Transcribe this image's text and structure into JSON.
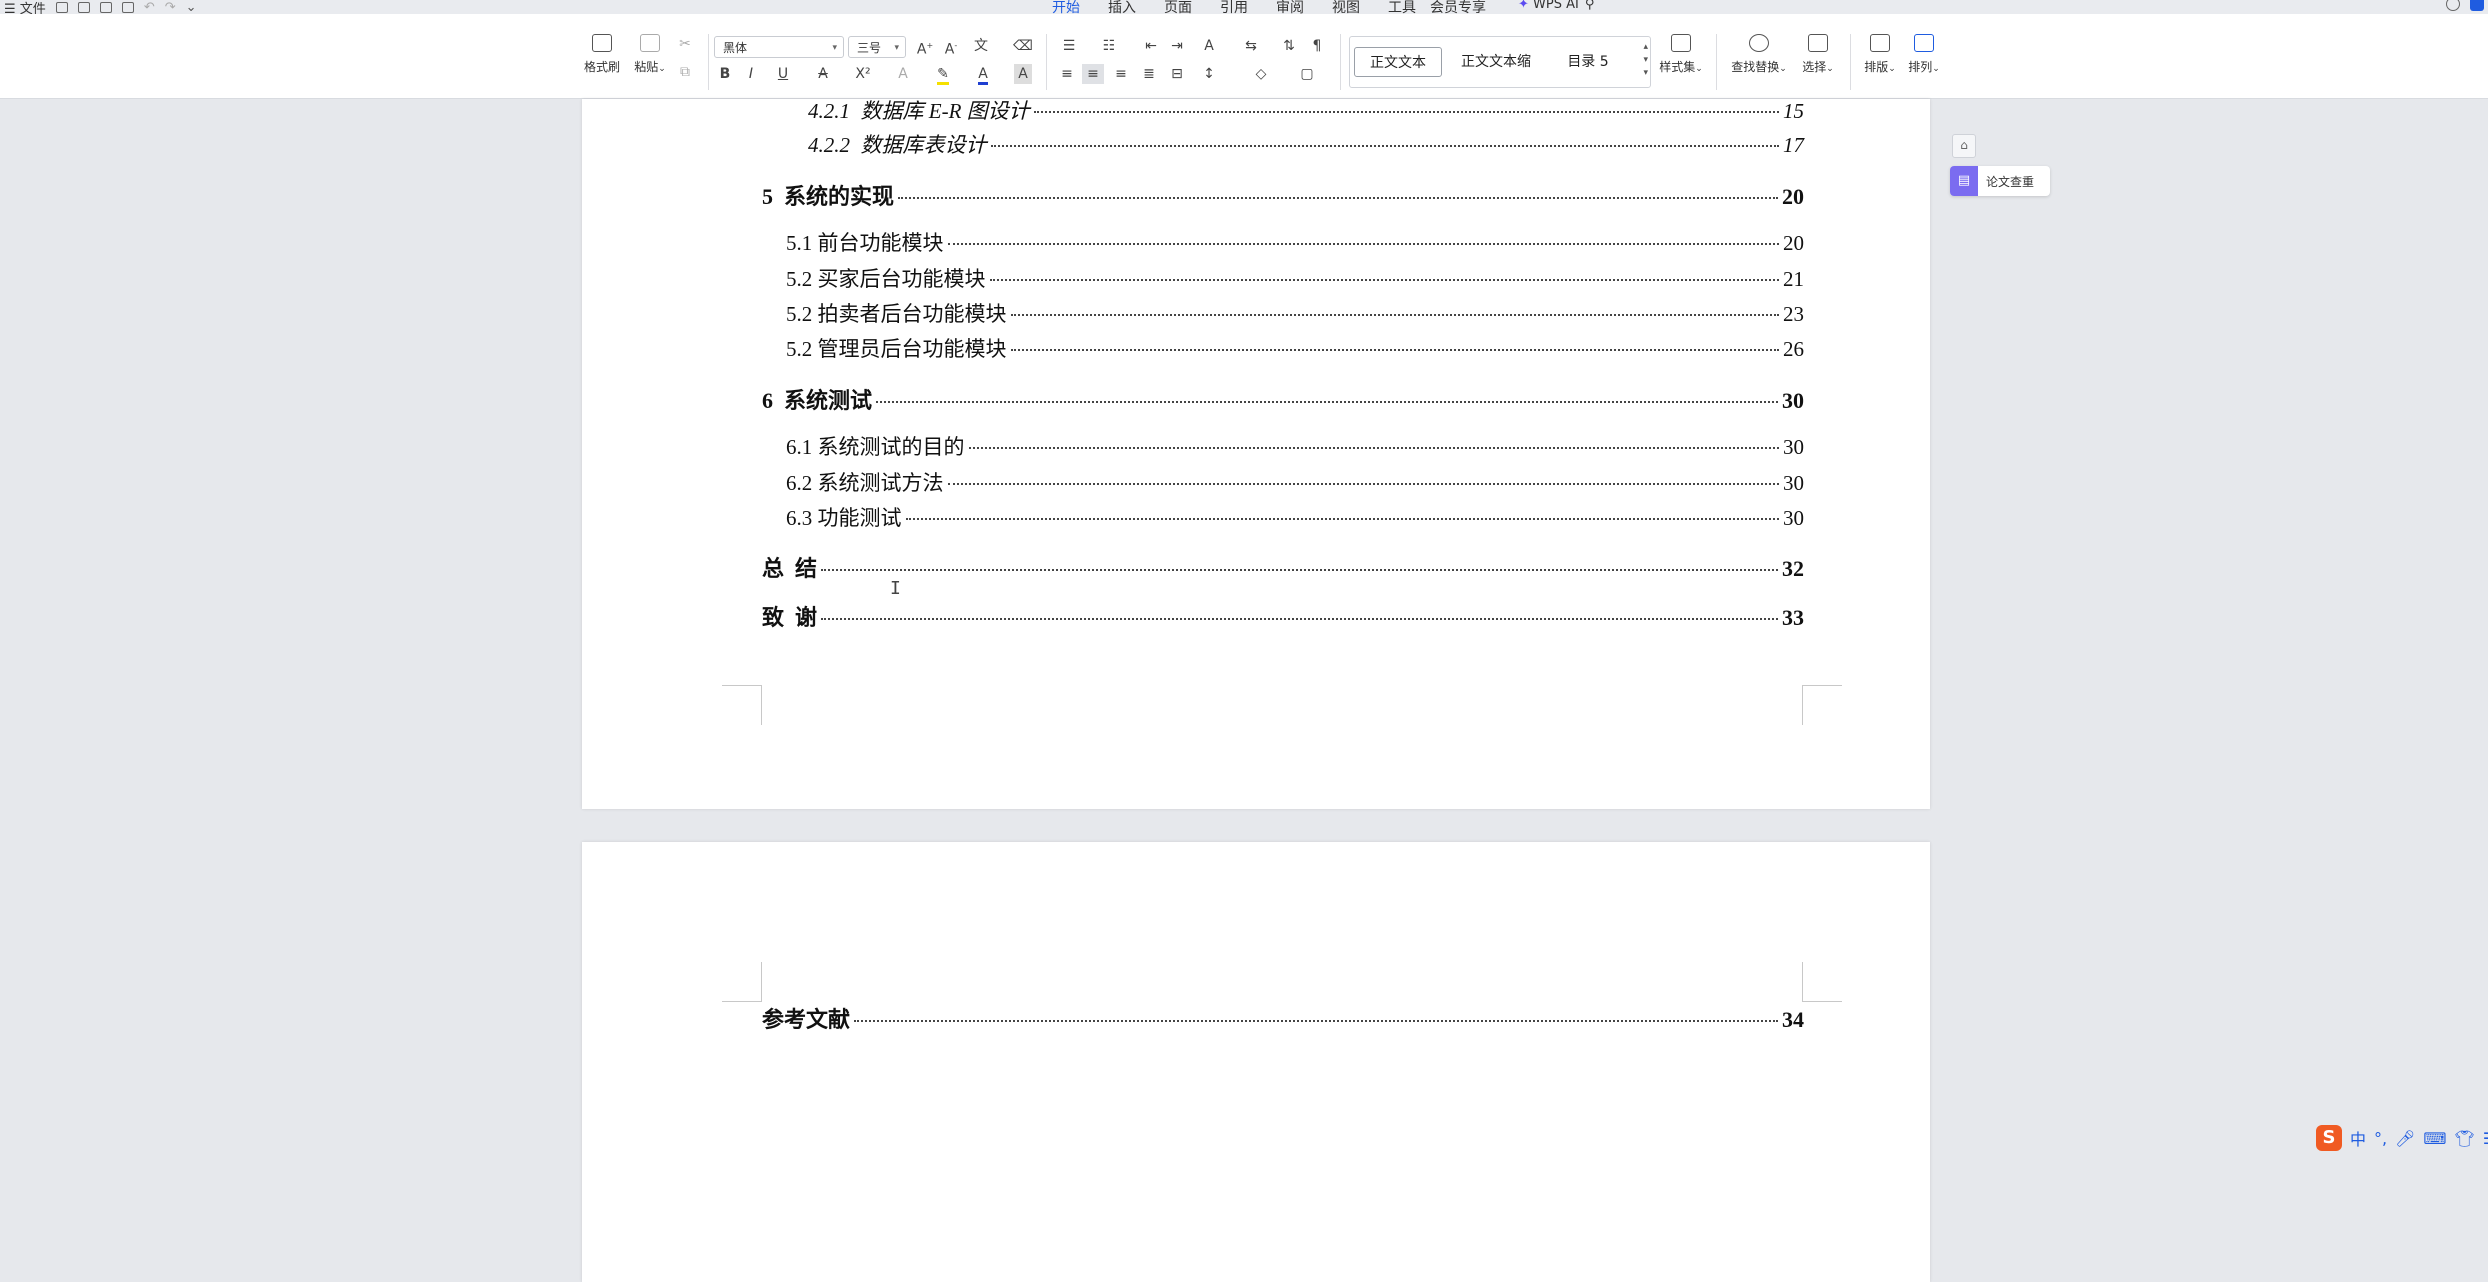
{
  "menubar": {
    "file_label": "文件",
    "tabs": [
      "开始",
      "插入",
      "页面",
      "引用",
      "审阅",
      "视图",
      "工具",
      "会员专享"
    ],
    "active_tab": "开始",
    "wps_ai_label": "WPS AI"
  },
  "ribbon": {
    "format_painter": "格式刷",
    "paste": "粘贴",
    "font_name": "黑体",
    "font_size": "三号",
    "styles": [
      "正文文本",
      "正文文本缩",
      "目录 5"
    ],
    "style_set": "样式集",
    "find_replace": "查找替换",
    "select": "选择",
    "layout": "排版",
    "arrange": "排列",
    "font_color": "#1f3fd1",
    "highlight_color": "#f5e000"
  },
  "toc": {
    "page1": [
      {
        "num": "4.2.1",
        "title": "数据库 E-R 图设计",
        "page": "15"
      },
      {
        "num": "4.2.2",
        "title": "数据库表设计",
        "page": "17"
      },
      {
        "num": "5",
        "title": "系统的实现",
        "page": "20"
      },
      {
        "num": "5.1",
        "title": "前台功能模块",
        "page": "20"
      },
      {
        "num": "5.2",
        "title": "买家后台功能模块",
        "page": "21"
      },
      {
        "num": "5.2",
        "title": "拍卖者后台功能模块",
        "page": "23"
      },
      {
        "num": "5.2",
        "title": "管理员后台功能模块",
        "page": "26"
      },
      {
        "num": "6",
        "title": "系统测试",
        "page": "30"
      },
      {
        "num": "6.1",
        "title": "系统测试的目的",
        "page": "30"
      },
      {
        "num": "6.2",
        "title": "系统测试方法",
        "page": "30"
      },
      {
        "num": "6.3",
        "title": "功能测试",
        "page": "30"
      },
      {
        "num": "",
        "title": "总  结",
        "page": "32"
      },
      {
        "num": "",
        "title": "致  谢",
        "page": "33"
      }
    ],
    "page2": [
      {
        "num": "",
        "title": "参考文献",
        "page": "34"
      }
    ]
  },
  "side": {
    "paper_check": "论文查重"
  },
  "ime": {
    "mode": "中",
    "punct": "°,"
  }
}
